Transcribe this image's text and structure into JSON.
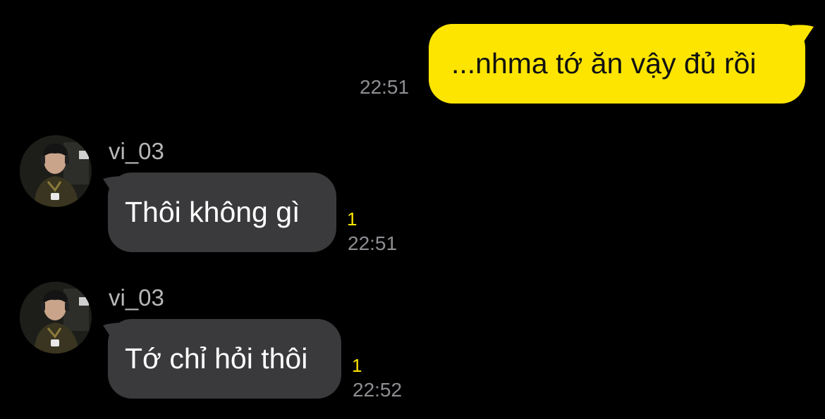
{
  "messages": [
    {
      "direction": "outgoing",
      "text": "...nhma tớ ăn vậy đủ rồi",
      "time": "22:51"
    },
    {
      "direction": "incoming",
      "sender": "vi_03",
      "text": "Thôi không gì",
      "unread": "1",
      "time": "22:51"
    },
    {
      "direction": "incoming",
      "sender": "vi_03",
      "text": "Tớ chỉ hỏi thôi",
      "unread": "1",
      "time": "22:52"
    }
  ],
  "colors": {
    "background": "#000000",
    "outgoing_bubble": "#fee500",
    "incoming_bubble": "#3a3a3c",
    "unread_count": "#fee500",
    "timestamp": "#8e8e93"
  }
}
